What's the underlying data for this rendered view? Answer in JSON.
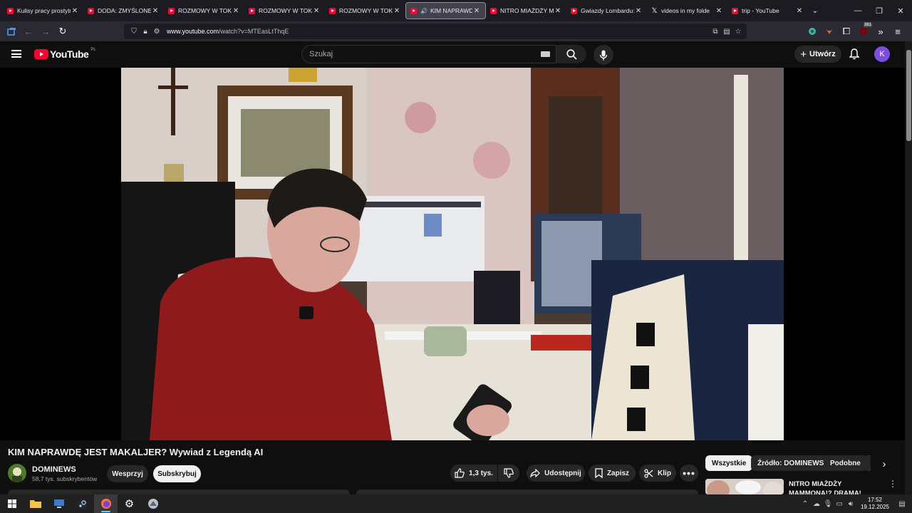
{
  "browser": {
    "tabs": [
      {
        "label": "Kulisy pracy prostytu",
        "icon": "youtube-icon",
        "active": false
      },
      {
        "label": "DODA: ZMYŚLONE Z",
        "icon": "youtube-icon",
        "active": false
      },
      {
        "label": "ROZMOWY W TOKU",
        "icon": "youtube-icon",
        "active": false
      },
      {
        "label": "ROZMOWY W TOKU",
        "icon": "youtube-icon",
        "active": false
      },
      {
        "label": "ROZMOWY W TOKU",
        "icon": "youtube-icon",
        "active": false
      },
      {
        "label": "KIM NAPRAWDĘ",
        "icon": "youtube-icon",
        "active": true,
        "playing_audio": true
      },
      {
        "label": "NITRO MIAŻDŻY MA",
        "icon": "youtube-icon",
        "active": false
      },
      {
        "label": "Gwiazdy Lombardu: N",
        "icon": "youtube-icon",
        "active": false
      },
      {
        "label": "videos in my folde",
        "icon": "x-icon",
        "active": false
      },
      {
        "label": "trip - YouTube",
        "icon": "youtube-icon",
        "active": false
      }
    ],
    "url_domain": "www.youtube.com",
    "url_path": "/watch?v=MTEasLtThqE",
    "extension_badge": "381"
  },
  "youtube": {
    "logo_text": "YouTube",
    "region": "PL",
    "search_placeholder": "Szukaj",
    "create_label": "Utwórz",
    "avatar_letter": "K",
    "accent_color": "#ff0033"
  },
  "video": {
    "title": "KIM NAPRAWDĘ JEST MAKALJER? Wywiad z Legendą AI",
    "channel_name": "DOMINEWS",
    "subscribers": "58,7 tys. subskrybentów",
    "support_label": "Wesprzyj",
    "subscribe_label": "Subskrybuj",
    "likes": "1,3 tys.",
    "share_label": "Udostępnij",
    "save_label": "Zapisz",
    "clip_label": "Klip"
  },
  "sidebar": {
    "chips": [
      "Wszystkie",
      "Źródło: DOMINEWS",
      "Podobne"
    ],
    "selected_chip": "Wszystkie",
    "recommendation_title": "NITRO MIAŻDŻY MAMMONA!? DRAMA! BRUCE DEBATA Z"
  },
  "taskbar": {
    "time": "17:52",
    "date": "19.12.2025"
  }
}
